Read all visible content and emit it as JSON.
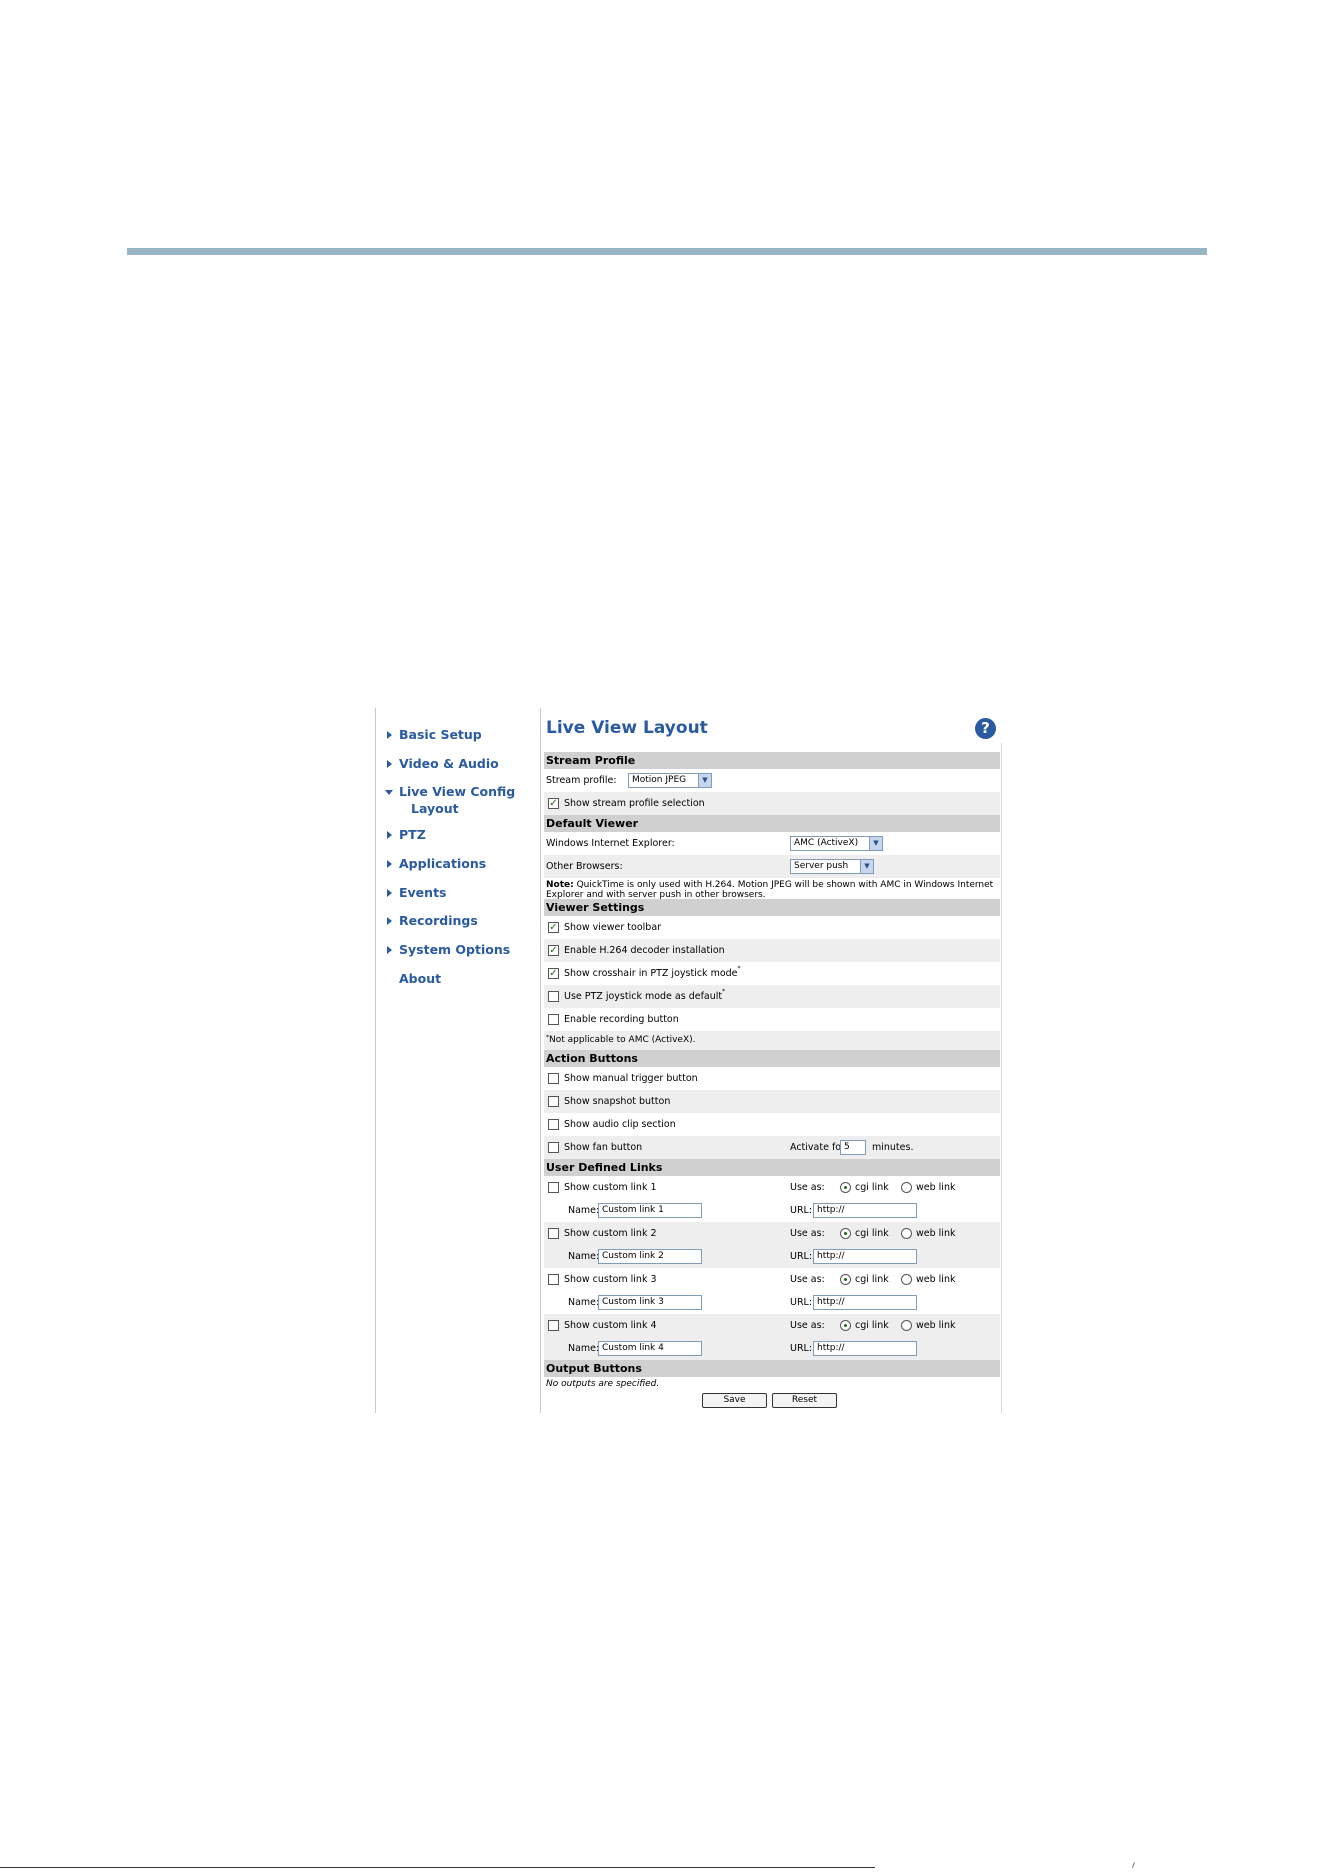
{
  "nav": {
    "items": [
      {
        "label": "Basic Setup"
      },
      {
        "label": "Video & Audio"
      },
      {
        "label": "Live View Config",
        "sub": "Layout"
      },
      {
        "label": "PTZ"
      },
      {
        "label": "Applications"
      },
      {
        "label": "Events"
      },
      {
        "label": "Recordings"
      },
      {
        "label": "System Options"
      },
      {
        "label": "About"
      }
    ]
  },
  "page": {
    "title": "Live View Layout",
    "help_icon": "?"
  },
  "stream_profile": {
    "heading": "Stream Profile",
    "label": "Stream profile:",
    "value": "Motion JPEG",
    "show_selection_label": "Show stream profile selection",
    "show_selection_checked": true
  },
  "default_viewer": {
    "heading": "Default Viewer",
    "ie_label": "Windows Internet Explorer:",
    "ie_value": "AMC (ActiveX)",
    "other_label": "Other Browsers:",
    "other_value": "Server push",
    "note_bold": "Note:",
    "note_text": " QuickTime is only used with H.264. Motion JPEG will be shown with AMC in Windows Internet Explorer and with server push in other browsers."
  },
  "viewer_settings": {
    "heading": "Viewer Settings",
    "items": [
      {
        "label": "Show viewer toolbar",
        "checked": true,
        "sup": ""
      },
      {
        "label": "Enable H.264 decoder installation",
        "checked": true,
        "sup": ""
      },
      {
        "label": "Show crosshair in PTZ joystick mode",
        "checked": true,
        "sup": "*"
      },
      {
        "label": "Use PTZ joystick mode as default",
        "checked": false,
        "sup": "*"
      },
      {
        "label": "Enable recording button",
        "checked": false,
        "sup": ""
      }
    ],
    "footnote_mark": "*",
    "footnote": "Not applicable to AMC (ActiveX)."
  },
  "action_buttons": {
    "heading": "Action Buttons",
    "items": [
      {
        "label": "Show manual trigger button",
        "checked": false
      },
      {
        "label": "Show snapshot button",
        "checked": false
      },
      {
        "label": "Show audio clip section",
        "checked": false
      },
      {
        "label": "Show fan button",
        "checked": false
      }
    ],
    "activate_label": "Activate for",
    "activate_value": "5",
    "activate_unit": "minutes."
  },
  "user_links": {
    "heading": "User Defined Links",
    "use_as_label": "Use as:",
    "cgi_label": "cgi link",
    "web_label": "web link",
    "name_label": "Name:",
    "url_label": "URL:",
    "items": [
      {
        "label": "Show custom link 1",
        "name": "Custom link 1",
        "url": "http://"
      },
      {
        "label": "Show custom link 2",
        "name": "Custom link 2",
        "url": "http://"
      },
      {
        "label": "Show custom link 3",
        "name": "Custom link 3",
        "url": "http://"
      },
      {
        "label": "Show custom link 4",
        "name": "Custom link 4",
        "url": "http://"
      }
    ]
  },
  "output_buttons": {
    "heading": "Output Buttons",
    "message": "No outputs are specified."
  },
  "actions": {
    "save_label": "Save",
    "reset_label": "Reset"
  },
  "colors": {
    "accent": "#2a5aa0",
    "section_bg": "#d0d0d0",
    "alt_row": "#eeeeee",
    "rule": "#98b3c4"
  }
}
